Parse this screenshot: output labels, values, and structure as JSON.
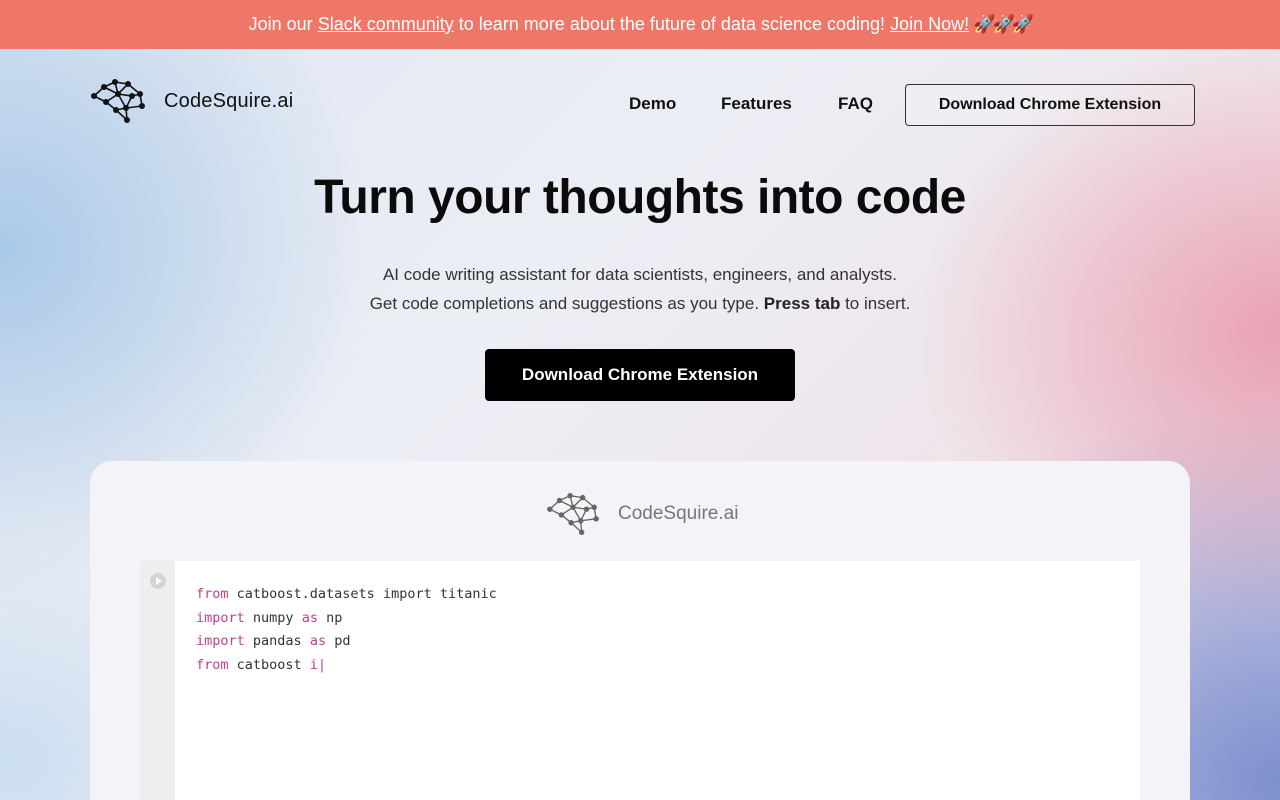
{
  "banner": {
    "prefix": "Join our",
    "link_text": "Slack community",
    "middle": "to learn more about the future of data science coding!",
    "cta_text": "Join Now!",
    "emoji": "🚀🚀🚀"
  },
  "header": {
    "brand": "CodeSquire.ai",
    "nav": {
      "demo": "Demo",
      "features": "Features",
      "faq": "FAQ",
      "cta": "Download Chrome Extension"
    }
  },
  "hero": {
    "title": "Turn your thoughts into code",
    "line1": "AI code writing assistant for data scientists, engineers, and analysts.",
    "line2_prefix": "Get code completions and suggestions as you type.",
    "line2_bold": "Press tab",
    "line2_suffix": "to insert.",
    "cta": "Download Chrome Extension"
  },
  "demo": {
    "brand": "CodeSquire.ai",
    "code_lines": [
      {
        "kw": "from",
        "rest": " catboost.datasets import titanic"
      },
      {
        "kw": "import",
        "rest": " numpy ",
        "kw2": "as",
        "rest2": " np"
      },
      {
        "kw": "import",
        "rest": " pandas ",
        "kw2": "as",
        "rest2": " pd"
      },
      {
        "kw": "from",
        "rest": " catboost ",
        "typing": "i|"
      }
    ]
  },
  "colors": {
    "banner_bg": "#ef7767",
    "keyword": "#c2408f",
    "cta_bg": "#000000"
  },
  "icons": {
    "logo": "neural-network-brain-icon",
    "run": "play-circle-icon"
  }
}
